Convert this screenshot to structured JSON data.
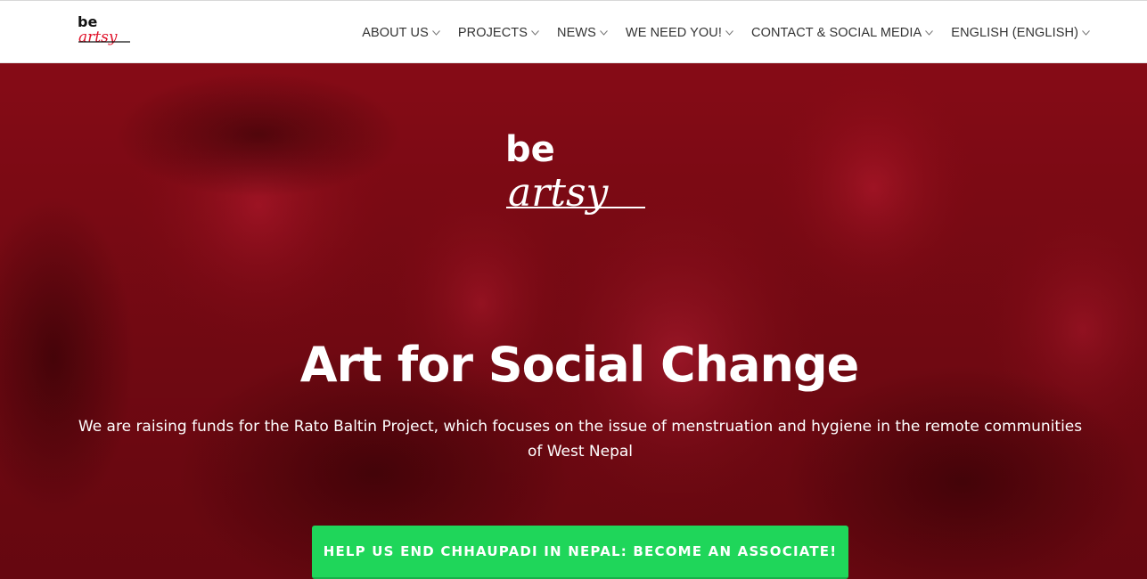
{
  "brand": {
    "logo_top": "be",
    "logo_script": "artsy",
    "accent_color": "#e0122a"
  },
  "nav": {
    "items": [
      {
        "label": "ABOUT US",
        "icon": "chevron-down-icon"
      },
      {
        "label": "PROJECTS",
        "icon": "chevron-down-icon"
      },
      {
        "label": "NEWS",
        "icon": "chevron-down-icon"
      },
      {
        "label": "WE NEED YOU!",
        "icon": "chevron-down-icon"
      },
      {
        "label": "CONTACT & SOCIAL MEDIA",
        "icon": "chevron-down-icon"
      },
      {
        "label": "ENGLISH (ENGLISH)",
        "icon": "chevron-down-icon"
      }
    ]
  },
  "hero": {
    "overlay_color": "#8a0a15",
    "title": "Art for Social Change",
    "description": "We are raising funds for the Rato Baltin Project, which focuses on the issue of menstruation and hygiene in the remote communities of West Nepal",
    "cta_label": "HELP US END CHHAUPADI IN NEPAL: BECOME AN ASSOCIATE!",
    "cta_color": "#1fd65a"
  }
}
